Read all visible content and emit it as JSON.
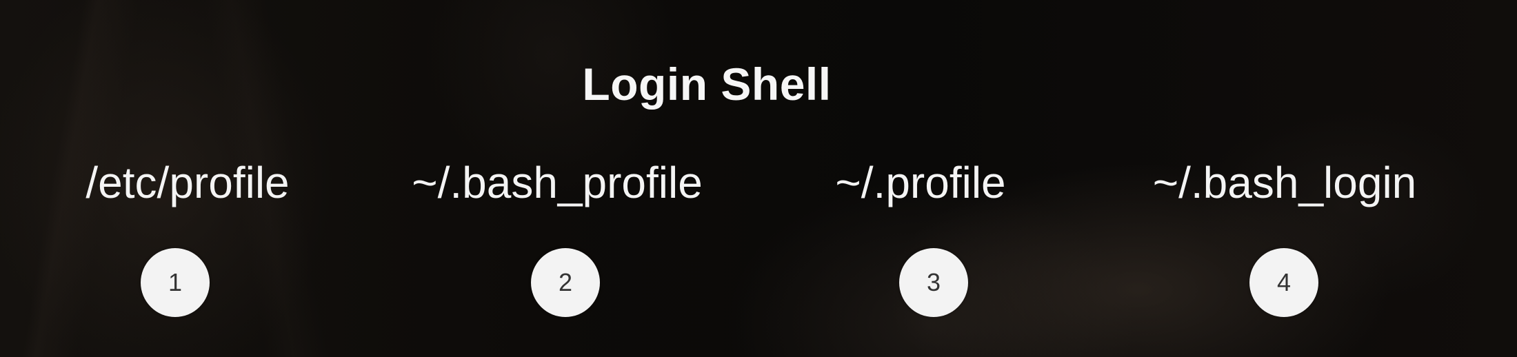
{
  "slide": {
    "title": "Login Shell",
    "files": [
      {
        "path": "/etc/profile",
        "order": "1"
      },
      {
        "path": "~/.bash_profile",
        "order": "2"
      },
      {
        "path": "~/.profile",
        "order": "3"
      },
      {
        "path": "~/.bash_login",
        "order": "4"
      }
    ]
  },
  "colors": {
    "text": "#f4f4f4",
    "badge_fill": "#f3f3f3",
    "badge_text": "#333333",
    "background": "#0b0907"
  }
}
